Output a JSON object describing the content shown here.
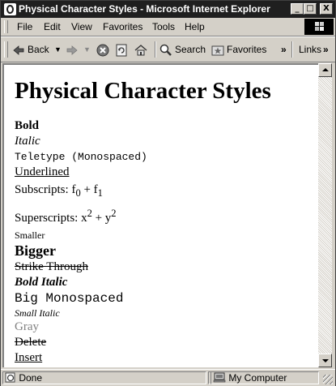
{
  "window": {
    "title": "Physical Character Styles - Microsoft Internet Explorer",
    "minimize": "_",
    "maximize": "□",
    "close": "X"
  },
  "menu": {
    "items": [
      "File",
      "Edit",
      "View",
      "Favorites",
      "Tools",
      "Help"
    ]
  },
  "toolbar": {
    "back_label": "Back",
    "search_label": "Search",
    "favorites_label": "Favorites",
    "overflow": "»",
    "links_label": "Links",
    "links_overflow": "»"
  },
  "page": {
    "heading": "Physical Character Styles",
    "bold": "Bold",
    "italic": "Italic",
    "teletype": "Teletype (Monospaced)",
    "underlined": "Underlined",
    "subscripts": {
      "label": "Subscripts: ",
      "base1": "f",
      "sub1": "0",
      "op": " + ",
      "base2": "f",
      "sub2": "1"
    },
    "superscripts": {
      "label": "Superscripts: ",
      "base1": "x",
      "sup1": "2",
      "op": " + ",
      "base2": "y",
      "sup2": "2"
    },
    "smaller": "Smaller",
    "bigger": "Bigger",
    "strike": "Strike Through",
    "bold_italic": "Bold Italic",
    "big_mono": "Big Monospaced",
    "small_italic": "Small Italic",
    "gray": "Gray",
    "delete": "Delete",
    "insert": "Insert"
  },
  "status": {
    "text": "Done",
    "zone": "My Computer"
  },
  "colors": {
    "gray_text": "#808080",
    "titlebar": "#1f1f1f"
  }
}
